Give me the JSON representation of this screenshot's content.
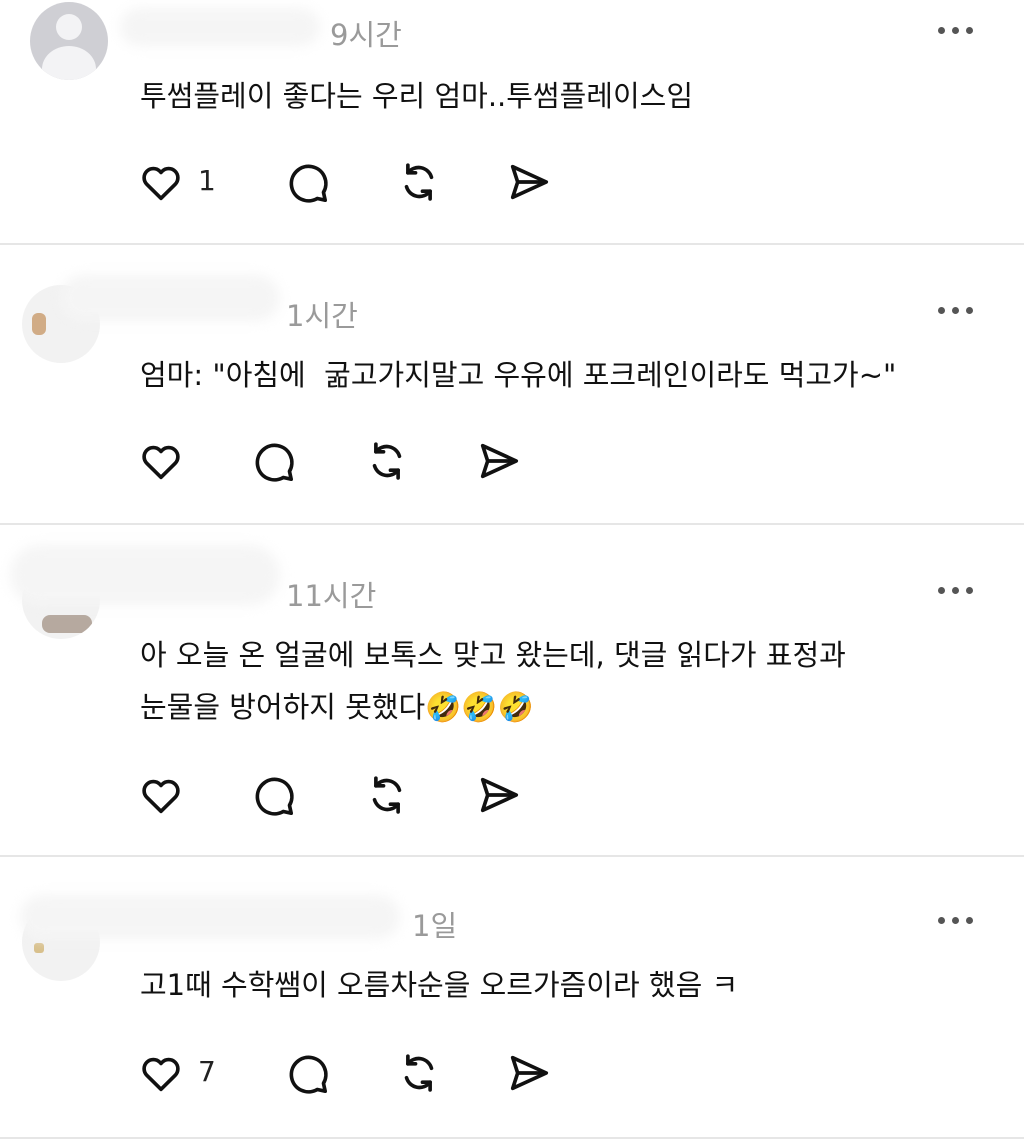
{
  "posts": [
    {
      "time": "9시간",
      "text": "투썸플레이 좋다는 우리 엄마..투썸플레이스임",
      "like_count": "1"
    },
    {
      "time": "1시간",
      "text": "엄마: \"아침에  굶고가지말고 우유에 포크레인이라도 먹고가~\"",
      "like_count": ""
    },
    {
      "time": "11시간",
      "text_line1": "아 오늘 온 얼굴에 보톡스 맞고 왔는데, 댓글 읽다가 표정과",
      "text_line2": "눈물을 방어하지 못했다🤣🤣🤣",
      "like_count": ""
    },
    {
      "time": "1일",
      "text": "고1때 수학쌤이 오름차순을 오르가즘이라 했음 ㅋ",
      "like_count": "7"
    }
  ],
  "icons": [
    "heart-icon",
    "comment-icon",
    "repost-icon",
    "share-icon",
    "more-icon"
  ]
}
